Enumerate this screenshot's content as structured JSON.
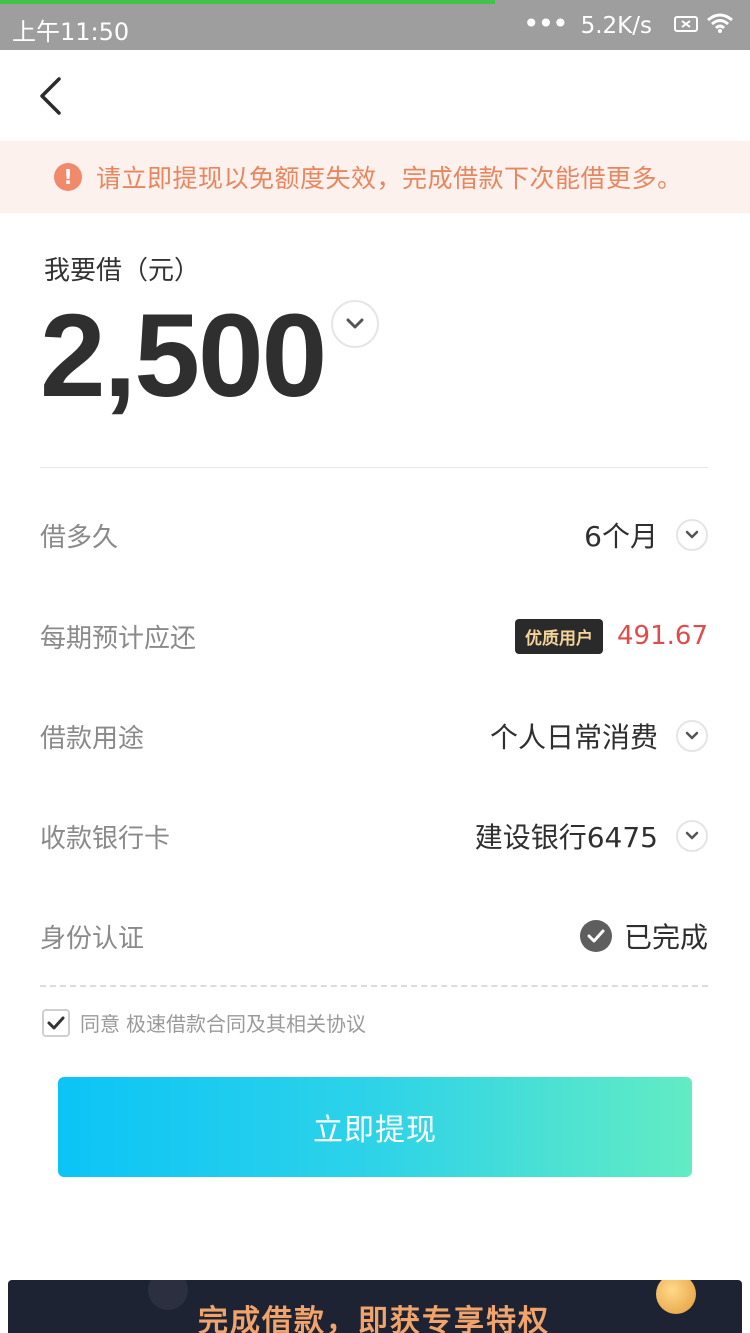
{
  "status_bar": {
    "time": "上午11:50",
    "network_speed": "5.2K/s"
  },
  "notice": {
    "text": "请立即提现以免额度失效，完成借款下次能借更多。"
  },
  "loan": {
    "amount_label": "我要借（元）",
    "amount_value": "2,500"
  },
  "rows": {
    "duration": {
      "label": "借多久",
      "value": "6个月"
    },
    "payment": {
      "label": "每期预计应还",
      "badge": "优质用户",
      "value": "491.67"
    },
    "purpose": {
      "label": "借款用途",
      "value": "个人日常消费"
    },
    "bank_card": {
      "label": "收款银行卡",
      "value": "建设银行6475"
    },
    "identity": {
      "label": "身份认证",
      "value": "已完成"
    }
  },
  "agreement": {
    "prefix": "同意",
    "link": "极速借款合同及其相关协议",
    "checked": true
  },
  "submit": {
    "label": "立即提现"
  },
  "banner": {
    "text": "完成借款，即获专享特权"
  },
  "colors": {
    "accent_gradient_start": "#0bc4f6",
    "accent_gradient_end": "#62ecc3",
    "payment_red": "#e04b4b",
    "notice_orange": "#e8865f"
  }
}
